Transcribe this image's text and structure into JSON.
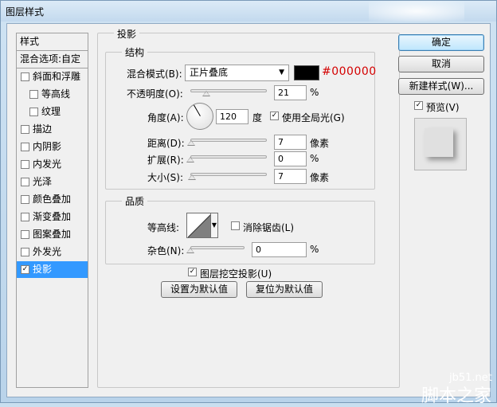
{
  "window": {
    "title": "图层样式"
  },
  "style_list": {
    "header": "样式",
    "blend_options": "混合选项:自定",
    "items": [
      {
        "label": "斜面和浮雕",
        "checked": false,
        "indent": false
      },
      {
        "label": "等高线",
        "checked": false,
        "indent": true
      },
      {
        "label": "纹理",
        "checked": false,
        "indent": true
      },
      {
        "label": "描边",
        "checked": false,
        "indent": false
      },
      {
        "label": "内阴影",
        "checked": false,
        "indent": false
      },
      {
        "label": "内发光",
        "checked": false,
        "indent": false
      },
      {
        "label": "光泽",
        "checked": false,
        "indent": false
      },
      {
        "label": "颜色叠加",
        "checked": false,
        "indent": false
      },
      {
        "label": "渐变叠加",
        "checked": false,
        "indent": false
      },
      {
        "label": "图案叠加",
        "checked": false,
        "indent": false
      },
      {
        "label": "外发光",
        "checked": false,
        "indent": false
      },
      {
        "label": "投影",
        "checked": true,
        "indent": false,
        "selected": true
      }
    ]
  },
  "drop_shadow": {
    "title": "投影",
    "structure": {
      "title": "结构",
      "blend_mode_label": "混合模式(B):",
      "blend_mode_value": "正片叠底",
      "color": "#000000",
      "color_text": "#000000",
      "opacity_label": "不透明度(O):",
      "opacity_value": "21",
      "opacity_unit": "%",
      "angle_label": "角度(A):",
      "angle_value": "120",
      "angle_unit": "度",
      "global_light_label": "使用全局光(G)",
      "global_light_checked": true,
      "distance_label": "距离(D):",
      "distance_value": "7",
      "distance_unit": "像素",
      "spread_label": "扩展(R):",
      "spread_value": "0",
      "spread_unit": "%",
      "size_label": "大小(S):",
      "size_value": "7",
      "size_unit": "像素"
    },
    "quality": {
      "title": "品质",
      "contour_label": "等高线:",
      "antialias_label": "消除锯齿(L)",
      "antialias_checked": false,
      "noise_label": "杂色(N):",
      "noise_value": "0",
      "noise_unit": "%"
    },
    "knockout_label": "图层挖空投影(U)",
    "knockout_checked": true,
    "make_default_button": "设置为默认值",
    "reset_default_button": "复位为默认值"
  },
  "buttons": {
    "ok": "确定",
    "cancel": "取消",
    "new_style": "新建样式(W)...",
    "preview_label": "预览(V)",
    "preview_checked": true
  },
  "watermark": {
    "site": "jb51.net",
    "name": "脚本之家"
  }
}
